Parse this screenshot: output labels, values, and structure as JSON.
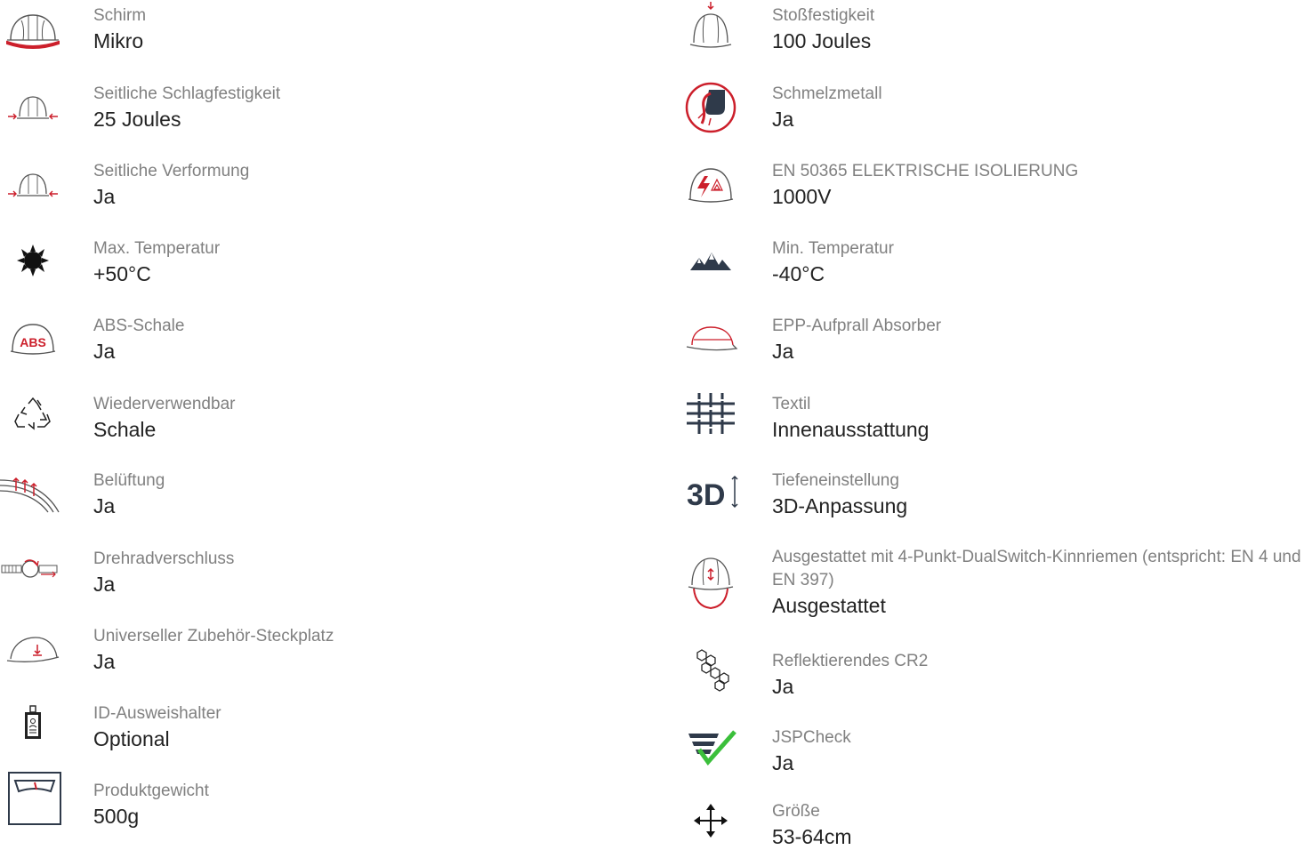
{
  "colors": {
    "accent": "#cc1f2b",
    "icon_dark": "#2f3a4a",
    "outline": "#555555",
    "check": "#3bbf3b",
    "label": "#808080",
    "value": "#222222"
  },
  "left": [
    {
      "icon": "helmet-brim-icon",
      "label": "Schirm",
      "value": "Mikro"
    },
    {
      "icon": "side-impact-icon",
      "label": "Seitliche Schlagfestigkeit",
      "value": "25 Joules"
    },
    {
      "icon": "side-deformation-icon",
      "label": "Seitliche Verformung",
      "value": "Ja"
    },
    {
      "icon": "sun-temperature-icon",
      "label": "Max. Temperatur",
      "value": "+50°C"
    },
    {
      "icon": "abs-shell-icon",
      "label": "ABS-Schale",
      "value": "Ja",
      "icon_text": "ABS"
    },
    {
      "icon": "recycle-icon",
      "label": "Wiederverwendbar",
      "value": "Schale"
    },
    {
      "icon": "ventilation-icon",
      "label": "Belüftung",
      "value": "Ja"
    },
    {
      "icon": "ratchet-wheel-icon",
      "label": "Drehradverschluss",
      "value": "Ja"
    },
    {
      "icon": "accessory-slot-icon",
      "label": "Universeller Zubehör-Steckplatz",
      "value": "Ja"
    },
    {
      "icon": "id-badge-icon",
      "label": "ID-Ausweishalter",
      "value": "Optional"
    },
    {
      "icon": "weight-scale-icon",
      "label": "Produktgewicht",
      "value": "500g"
    }
  ],
  "right": [
    {
      "icon": "top-impact-icon",
      "label": "Stoßfestigkeit",
      "value": "100 Joules"
    },
    {
      "icon": "molten-metal-icon",
      "label": "Schmelzmetall",
      "value": "Ja"
    },
    {
      "icon": "electrical-insulation-icon",
      "label": "EN 50365 ELEKTRISCHE ISOLIERUNG",
      "value": "1000V"
    },
    {
      "icon": "mountain-temperature-icon",
      "label": "Min. Temperatur",
      "value": "-40°C"
    },
    {
      "icon": "epp-absorber-icon",
      "label": "EPP-Aufprall Absorber",
      "value": "Ja"
    },
    {
      "icon": "textile-icon",
      "label": "Textil",
      "value": "Innenausstattung"
    },
    {
      "icon": "3d-adjustment-icon",
      "label": "Tiefeneinstellung",
      "value": "3D-Anpassung",
      "icon_text": "3D"
    },
    {
      "icon": "chinstrap-icon",
      "label": "Ausgestattet mit 4-Punkt-DualSwitch-Kinnriemen (entspricht: EN 4 und EN 397)",
      "value": "Ausgestattet"
    },
    {
      "icon": "reflective-hexagon-icon",
      "label": "Reflektierendes CR2",
      "value": "Ja"
    },
    {
      "icon": "jspcheck-icon",
      "label": "JSPCheck",
      "value": "Ja"
    },
    {
      "icon": "size-arrows-icon",
      "label": "Größe",
      "value": "53-64cm"
    }
  ]
}
